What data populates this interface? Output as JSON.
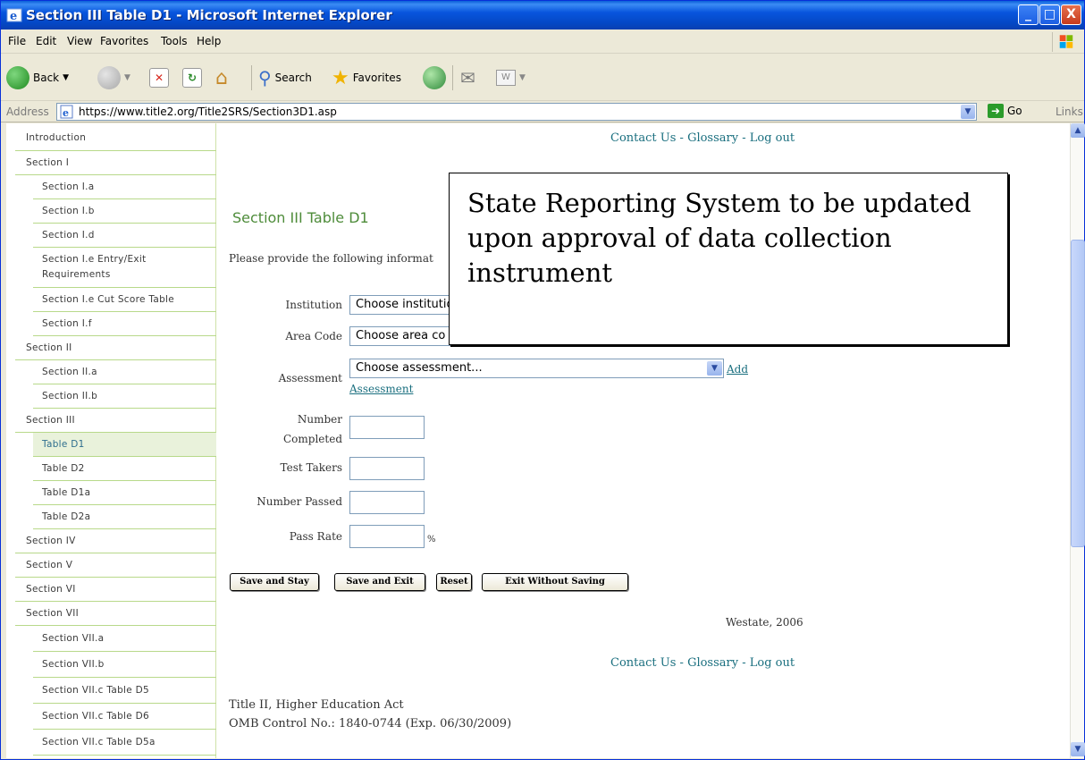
{
  "window": {
    "title": "Section III Table D1 - Microsoft Internet Explorer",
    "controls": [
      "_",
      "□",
      "X"
    ]
  },
  "menu": [
    "File",
    "Edit",
    "View",
    "Favorites",
    "Tools",
    "Help"
  ],
  "toolbar": {
    "back_label": "Back",
    "search_label": "Search",
    "favorites_label": "Favorites"
  },
  "address": {
    "label": "Address",
    "url": "https://www.title2.org/Title2SRS/Section3D1.asp",
    "go_label": "Go",
    "links_label": "Links"
  },
  "nav": {
    "items": [
      {
        "label": "Introduction",
        "level": 0
      },
      {
        "label": "Section I",
        "level": 0
      },
      {
        "label": "Section I.a",
        "level": 1
      },
      {
        "label": "Section I.b",
        "level": 1
      },
      {
        "label": "Section I.d",
        "level": 1
      },
      {
        "label": "Section I.e Entry/Exit Requirements",
        "level": 1
      },
      {
        "label": "Section I.e Cut Score Table",
        "level": 1
      },
      {
        "label": "Section I.f",
        "level": 1
      },
      {
        "label": "Section II",
        "level": 0
      },
      {
        "label": "Section II.a",
        "level": 1
      },
      {
        "label": "Section II.b",
        "level": 1
      },
      {
        "label": "Section III",
        "level": 0
      },
      {
        "label": "Table D1",
        "level": 1,
        "active": true
      },
      {
        "label": "Table D2",
        "level": 1
      },
      {
        "label": "Table D1a",
        "level": 1
      },
      {
        "label": "Table D2a",
        "level": 1
      },
      {
        "label": "Section IV",
        "level": 0
      },
      {
        "label": "Section V",
        "level": 0
      },
      {
        "label": "Section VI",
        "level": 0
      },
      {
        "label": "Section VII",
        "level": 0
      },
      {
        "label": "Section VII.a",
        "level": 1
      },
      {
        "label": "Section VII.b",
        "level": 1
      },
      {
        "label": "Section VII.c Table D5",
        "level": 1
      },
      {
        "label": "Section VII.c Table D6",
        "level": 1
      },
      {
        "label": "Section VII.c Table D5a",
        "level": 1
      }
    ]
  },
  "links": {
    "contact": "Contact Us",
    "glossary": "Glossary",
    "logout": "Log out",
    "sep": " - "
  },
  "page": {
    "heading": "Section III Table D1",
    "instructions": "Please provide the following informat"
  },
  "form": {
    "institution_label": "Institution",
    "institution_value": "Choose institutio",
    "area_code_label": "Area Code",
    "area_code_value": "Choose area co",
    "assessment_label": "Assessment",
    "assessment_value": "Choose assessment...",
    "add_assessment_1": "Add",
    "add_assessment_2": "Assessment",
    "number_completed_label_1": "Number",
    "number_completed_label_2": "Completed",
    "test_takers_label": "Test Takers",
    "number_passed_label": "Number Passed",
    "pass_rate_label": "Pass Rate",
    "pass_rate_unit": "%"
  },
  "buttons": {
    "save_stay": "Save and Stay",
    "save_exit": "Save and Exit",
    "reset": "Reset",
    "exit_no_save": "Exit Without Saving"
  },
  "footer": {
    "copyright": "Westate, 2006",
    "legal_line1": "Title II, Higher Education Act",
    "legal_line2": "OMB Control No.: 1840-0744 (Exp. 06/30/2009)"
  },
  "callout": {
    "text": "State Reporting System to be updated upon approval of data collection instrument"
  }
}
